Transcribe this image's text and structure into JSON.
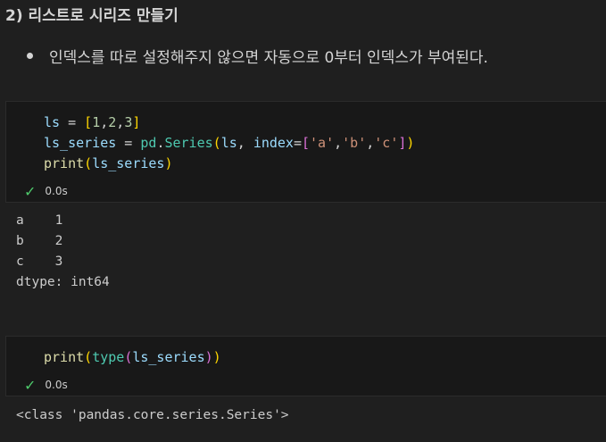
{
  "section": {
    "heading": "2) 리스트로 시리즈 만들기",
    "bullet": "인덱스를 따로 설정해주지 않으면 자동으로 0부터 인덱스가 부여된다."
  },
  "cells": [
    {
      "code": {
        "line1": {
          "var": "ls",
          "eq": " = ",
          "open": "[",
          "n1": "1",
          "c1": ",",
          "n2": "2",
          "c2": ",",
          "n3": "3",
          "close": "]"
        },
        "line2": {
          "var": "ls_series",
          "eq": " = ",
          "mod": "pd",
          "dot": ".",
          "cls": "Series",
          "open": "(",
          "arg1": "ls",
          "comma": ", ",
          "kw": "index",
          "eq2": "=",
          "lopen": "[",
          "s1": "'a'",
          "c1": ",",
          "s2": "'b'",
          "c2": ",",
          "s3": "'c'",
          "lclose": "]",
          "close": ")"
        },
        "line3": {
          "fn": "print",
          "open": "(",
          "arg": "ls_series",
          "close": ")"
        }
      },
      "status": {
        "icon": "check-icon",
        "time": "0.0s"
      },
      "output": {
        "lines": [
          "a    1",
          "b    2",
          "c    3",
          "dtype: int64"
        ]
      }
    },
    {
      "code": {
        "line1": {
          "fn": "print",
          "open": "(",
          "fn2": "type",
          "open2": "(",
          "arg": "ls_series",
          "close2": ")",
          "close": ")"
        }
      },
      "status": {
        "icon": "check-icon",
        "time": "0.0s"
      },
      "output": {
        "lines": [
          "<class 'pandas.core.series.Series'>"
        ]
      }
    }
  ],
  "colors": {
    "background": "#1f1f1f",
    "cell_background": "#181818",
    "success": "#4ec96b",
    "variable": "#9cdcfe",
    "function": "#dcdcaa",
    "class": "#4ec9b0",
    "number": "#b5cea8",
    "string": "#ce9178"
  }
}
